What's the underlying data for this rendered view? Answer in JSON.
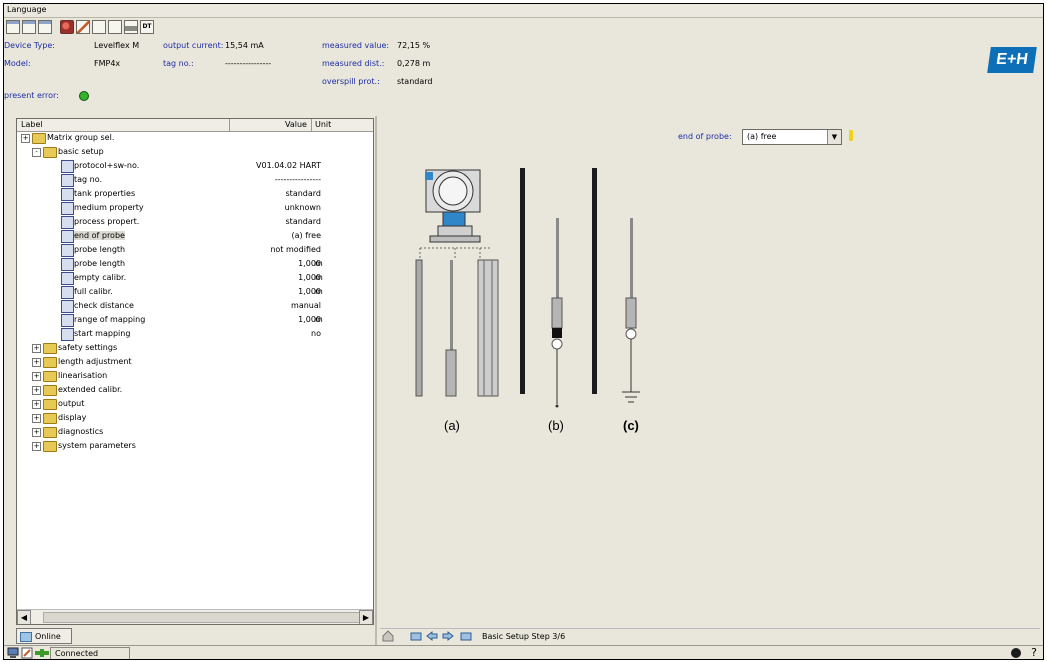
{
  "menu": {
    "language": "Language"
  },
  "device": {
    "type_label": "Device Type:",
    "type_value": "Levelflex M",
    "model_label": "Model:",
    "model_value": "FMP4x",
    "error_label": "present error:",
    "output_current_label": "output current:",
    "output_current_value": "15,54 mA",
    "tag_label": "tag no.:",
    "tag_value": "----------------",
    "measured_value_label": "measured value:",
    "measured_value_value": "72,15 %",
    "measured_dist_label": "measured dist.:",
    "measured_dist_value": "0,278 m",
    "overspill_label": "overspill prot.:",
    "overspill_value": "standard",
    "logo_text": "E+H"
  },
  "table": {
    "col_label": "Label",
    "col_value": "Value",
    "col_unit": "Unit"
  },
  "tree": [
    {
      "label": "Matrix group sel.",
      "value": "",
      "unit": "",
      "kind": "folder",
      "level": 0,
      "exp": "+"
    },
    {
      "label": "basic setup",
      "value": "",
      "unit": "",
      "kind": "folder",
      "level": 1,
      "exp": "-"
    },
    {
      "label": "protocol+sw-no.",
      "value": "V01.04.02 HART",
      "unit": "",
      "kind": "item",
      "level": 2
    },
    {
      "label": "tag no.",
      "value": "----------------",
      "unit": "",
      "kind": "item",
      "level": 2
    },
    {
      "label": "tank properties",
      "value": "standard",
      "unit": "",
      "kind": "item",
      "level": 2
    },
    {
      "label": "medium property",
      "value": "unknown",
      "unit": "",
      "kind": "item",
      "level": 2
    },
    {
      "label": "process propert.",
      "value": "standard",
      "unit": "",
      "kind": "item",
      "level": 2
    },
    {
      "label": "end of probe",
      "value": "(a) free",
      "unit": "",
      "kind": "item",
      "level": 2,
      "selected": true
    },
    {
      "label": "probe length",
      "value": "not modified",
      "unit": "",
      "kind": "item",
      "level": 2
    },
    {
      "label": "probe length",
      "value": "1,000",
      "unit": "m",
      "kind": "item",
      "level": 2
    },
    {
      "label": "empty calibr.",
      "value": "1,000",
      "unit": "m",
      "kind": "item",
      "level": 2
    },
    {
      "label": "full calibr.",
      "value": "1,000",
      "unit": "m",
      "kind": "item",
      "level": 2
    },
    {
      "label": "check distance",
      "value": "manual",
      "unit": "",
      "kind": "item",
      "level": 2
    },
    {
      "label": "range of mapping",
      "value": "1,000",
      "unit": "m",
      "kind": "item",
      "level": 2
    },
    {
      "label": "start mapping",
      "value": "no",
      "unit": "",
      "kind": "item",
      "level": 2
    },
    {
      "label": "safety settings",
      "value": "",
      "unit": "",
      "kind": "folder",
      "level": 1,
      "exp": "+"
    },
    {
      "label": "length adjustment",
      "value": "",
      "unit": "",
      "kind": "folder",
      "level": 1,
      "exp": "+"
    },
    {
      "label": "linearisation",
      "value": "",
      "unit": "",
      "kind": "folder",
      "level": 1,
      "exp": "+"
    },
    {
      "label": "extended calibr.",
      "value": "",
      "unit": "",
      "kind": "folder",
      "level": 1,
      "exp": "+"
    },
    {
      "label": "output",
      "value": "",
      "unit": "",
      "kind": "folder",
      "level": 1,
      "exp": "+"
    },
    {
      "label": "display",
      "value": "",
      "unit": "",
      "kind": "folder",
      "level": 1,
      "exp": "+"
    },
    {
      "label": "diagnostics",
      "value": "",
      "unit": "",
      "kind": "folder",
      "level": 1,
      "exp": "+"
    },
    {
      "label": "system parameters",
      "value": "",
      "unit": "",
      "kind": "folder",
      "level": 1,
      "exp": "+"
    }
  ],
  "online_tab": "Online",
  "end_of_probe": {
    "label": "end of probe:",
    "value": "(a) free"
  },
  "diagram": {
    "a": "(a)",
    "b": "(b)",
    "c": "(c)"
  },
  "step": "Basic Setup Step 3/6",
  "status": {
    "connection": "Connected",
    "help": "?"
  },
  "colors": {
    "logo": "#0d6fb8",
    "link_blue": "#1f2ea6",
    "led_green": "#35b22b"
  }
}
